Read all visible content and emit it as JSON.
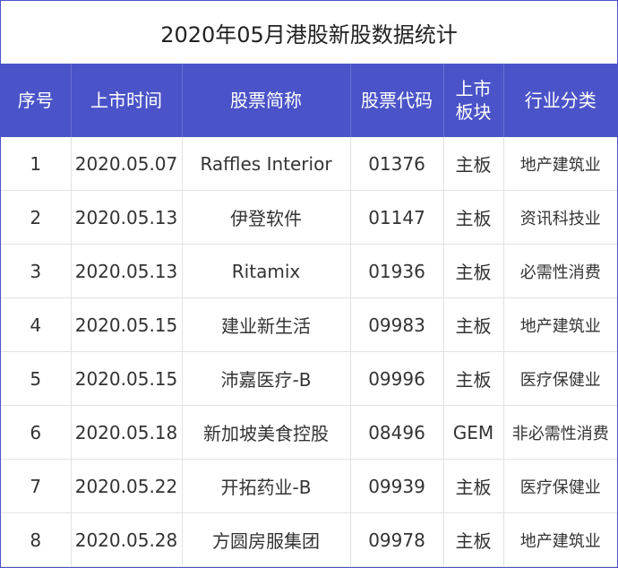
{
  "title": "2020年05月港股新股数据统计",
  "headers": {
    "index": "序号",
    "date": "上市时间",
    "name": "股票简称",
    "code": "股票代码",
    "board_line1": "上市",
    "board_line2": "板块",
    "industry": "行业分类"
  },
  "rows": [
    {
      "index": "1",
      "date": "2020.05.07",
      "name": "Raffles Interior",
      "code": "01376",
      "board": "主板",
      "industry": "地产建筑业"
    },
    {
      "index": "2",
      "date": "2020.05.13",
      "name": "伊登软件",
      "code": "01147",
      "board": "主板",
      "industry": "资讯科技业"
    },
    {
      "index": "3",
      "date": "2020.05.13",
      "name": "Ritamix",
      "code": "01936",
      "board": "主板",
      "industry": "必需性消费"
    },
    {
      "index": "4",
      "date": "2020.05.15",
      "name": "建业新生活",
      "code": "09983",
      "board": "主板",
      "industry": "地产建筑业"
    },
    {
      "index": "5",
      "date": "2020.05.15",
      "name": "沛嘉医疗-B",
      "code": "09996",
      "board": "主板",
      "industry": "医疗保健业"
    },
    {
      "index": "6",
      "date": "2020.05.18",
      "name": "新加坡美食控股",
      "code": "08496",
      "board": "GEM",
      "industry": "非必需性消费"
    },
    {
      "index": "7",
      "date": "2020.05.22",
      "name": "开拓药业-B",
      "code": "09939",
      "board": "主板",
      "industry": "医疗保健业"
    },
    {
      "index": "8",
      "date": "2020.05.28",
      "name": "方圆房服集团",
      "code": "09978",
      "board": "主板",
      "industry": "地产建筑业"
    }
  ]
}
